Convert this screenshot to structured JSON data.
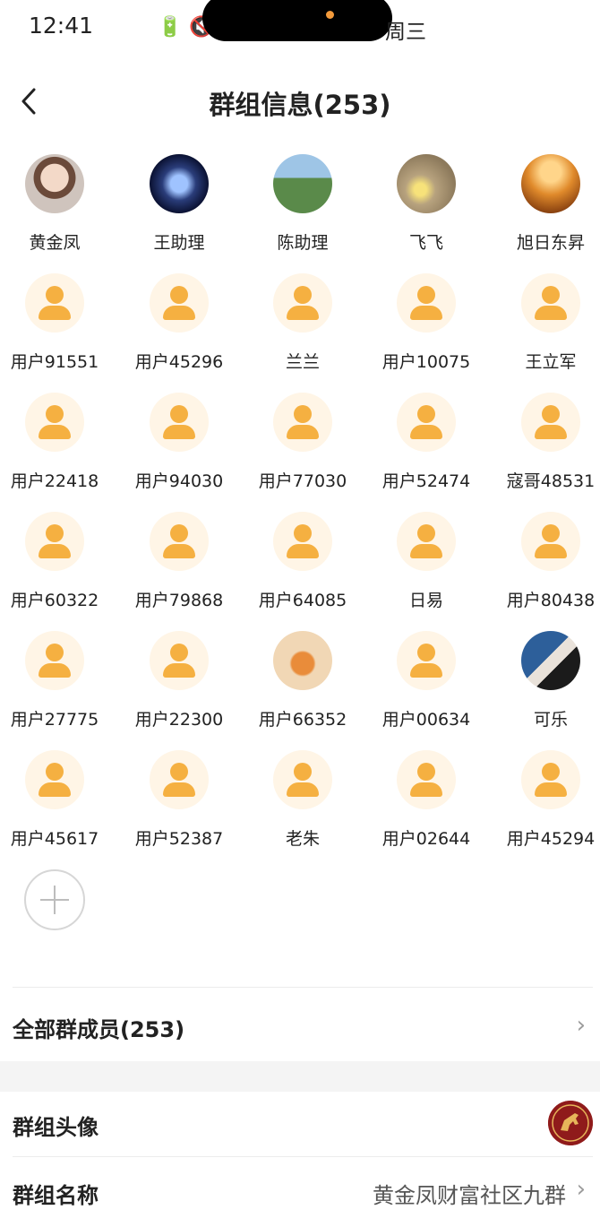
{
  "status_bar": {
    "time": "12:41",
    "day": "周三"
  },
  "header": {
    "title": "群组信息(253)"
  },
  "members": [
    {
      "name": "黄金凤",
      "avatar": "photo-woman"
    },
    {
      "name": "王助理",
      "avatar": "photo-blue-art"
    },
    {
      "name": "陈助理",
      "avatar": "photo-woman-outdoor"
    },
    {
      "name": "飞飞",
      "avatar": "photo-flowers"
    },
    {
      "name": "旭日东昇",
      "avatar": "photo-horse-sunset"
    },
    {
      "name": "用户91551",
      "avatar": "default"
    },
    {
      "name": "用户45296",
      "avatar": "default"
    },
    {
      "name": "兰兰",
      "avatar": "default"
    },
    {
      "name": "用户10075",
      "avatar": "default"
    },
    {
      "name": "王立军",
      "avatar": "default"
    },
    {
      "name": "用户22418",
      "avatar": "default"
    },
    {
      "name": "用户94030",
      "avatar": "default"
    },
    {
      "name": "用户77030",
      "avatar": "default"
    },
    {
      "name": "用户52474",
      "avatar": "default"
    },
    {
      "name": "寇哥48531",
      "avatar": "default"
    },
    {
      "name": "用户60322",
      "avatar": "default"
    },
    {
      "name": "用户79868",
      "avatar": "default"
    },
    {
      "name": "用户64085",
      "avatar": "default"
    },
    {
      "name": "日易",
      "avatar": "default"
    },
    {
      "name": "用户80438",
      "avatar": "default"
    },
    {
      "name": "用户27775",
      "avatar": "default"
    },
    {
      "name": "用户22300",
      "avatar": "default"
    },
    {
      "name": "用户66352",
      "avatar": "photo-tiger"
    },
    {
      "name": "用户00634",
      "avatar": "default"
    },
    {
      "name": "可乐",
      "avatar": "photo-portrait-blue"
    },
    {
      "name": "用户45617",
      "avatar": "default"
    },
    {
      "name": "用户52387",
      "avatar": "default"
    },
    {
      "name": "老朱",
      "avatar": "default"
    },
    {
      "name": "用户02644",
      "avatar": "default"
    },
    {
      "name": "用户45294",
      "avatar": "default"
    }
  ],
  "all_members": {
    "label": "全部群成员(253)"
  },
  "group_avatar": {
    "label": "群组头像"
  },
  "group_name": {
    "label": "群组名称",
    "value": "黄金凤财富社区九群"
  },
  "colors": {
    "accent": "#f5b041",
    "default_avatar_bg": "#fff5e6",
    "divider": "#ececec"
  }
}
